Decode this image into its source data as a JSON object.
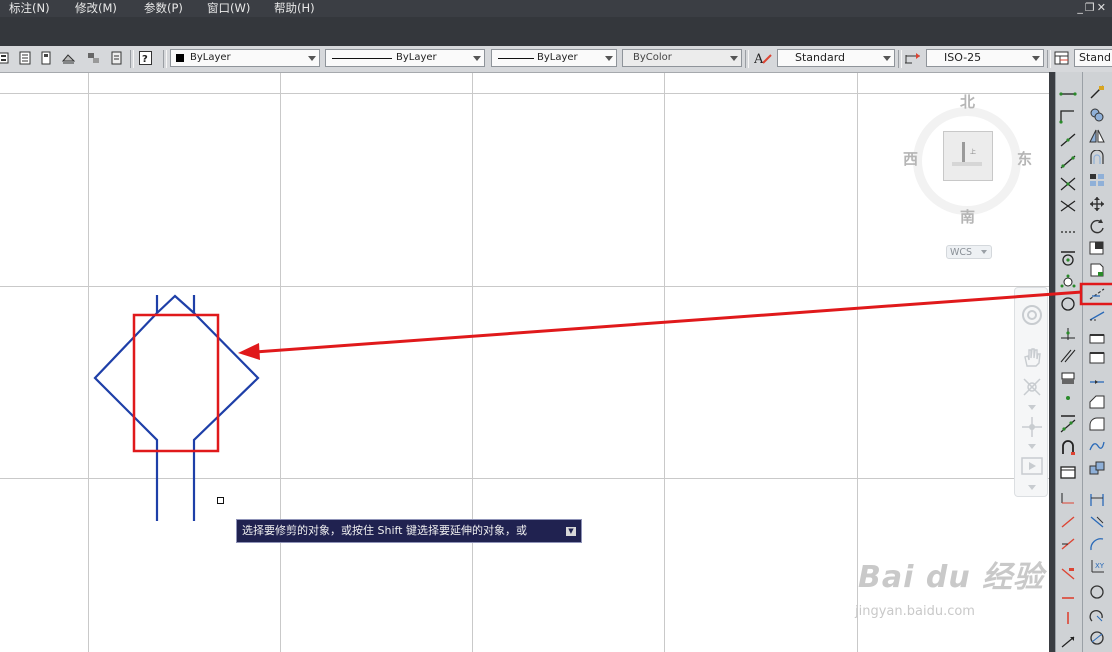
{
  "menu": {
    "items": [
      "标注(N)",
      "修改(M)",
      "参数(P)",
      "窗口(W)",
      "帮助(H)"
    ]
  },
  "toolbar": {
    "color_combo": "ByLayer",
    "linetype_combo": "ByLayer",
    "lineweight_combo": "ByLayer",
    "plotstyle_combo": "ByColor",
    "textstyle_combo": "Standard",
    "dimstyle_combo": "ISO-25",
    "tablestyle_combo": "Stand"
  },
  "viewcube": {
    "north": "北",
    "south": "南",
    "east": "东",
    "west": "西",
    "wcs_label": "WCS"
  },
  "tooltip": {
    "text": "选择要修剪的对象，或按住 Shift 键选择要延伸的对象，或"
  },
  "watermark": {
    "brand": "Bai du 经验",
    "url": "jingyan.baidu.com"
  },
  "colors": {
    "menubar_bg": "#3b3e44",
    "shape_stroke": "#1e3fa8",
    "highlight_red": "#e0191b",
    "tooltip_bg": "#202250"
  }
}
